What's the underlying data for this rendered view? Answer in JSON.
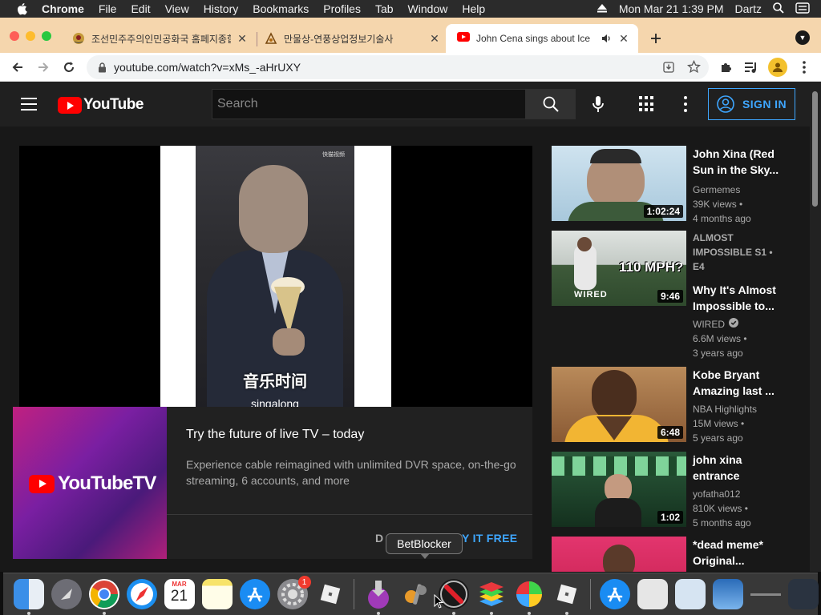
{
  "menubar": {
    "app": "Chrome",
    "items": [
      "File",
      "Edit",
      "View",
      "History",
      "Bookmarks",
      "Profiles",
      "Tab",
      "Window",
      "Help"
    ],
    "datetime": "Mon Mar 21  1:39 PM",
    "user": "Dartz"
  },
  "tabs": [
    {
      "title": "조선민주주의인민공화국 홈페지종합",
      "active": false
    },
    {
      "title": "만물상-연풍상업정보기술사",
      "active": false
    },
    {
      "title": "John Cena sings about Ice",
      "active": true
    }
  ],
  "toolbar": {
    "url": "youtube.com/watch?v=xMs_-aHrUXY"
  },
  "youtube": {
    "logo_text": "YouTube",
    "search_placeholder": "Search",
    "signin_label": "SIGN IN"
  },
  "video": {
    "watermark": "快猫视频",
    "caption": "音乐时间",
    "caption_sub": "singalong"
  },
  "promo": {
    "logo_text": "YouTubeTV",
    "title": "Try the future of live TV – today",
    "description": "Experience cable reimagined with unlimited DVR space, on-the-go streaming, 6 accounts, and more",
    "dismiss_label": "D",
    "try_label": "Y IT FREE"
  },
  "sidebar": [
    {
      "title": "John Xina (Red Sun in the Sky...",
      "channel": "Germemes",
      "views": "39K views",
      "age": "4 months ago",
      "duration": "1:02:24"
    },
    {
      "series": "ALMOST IMPOSSIBLE  S1 • E4",
      "title": "Why It's Almost Impossible to...",
      "channel": "WIRED",
      "verified": true,
      "views": "6.6M views",
      "age": "3 years ago",
      "duration": "9:46",
      "thumb_text": "110 MPH?",
      "thumb_brand": "WIRED"
    },
    {
      "title": "Kobe Bryant Amazing last ...",
      "channel": "NBA Highlights",
      "views": "15M views",
      "age": "5 years ago",
      "duration": "6:48"
    },
    {
      "title": "john xina entrance",
      "channel": "yofatha012",
      "views": "810K views",
      "age": "5 months ago",
      "duration": "1:02"
    },
    {
      "title": "*dead meme* Original...",
      "channel": "",
      "views": "",
      "age": "",
      "duration": ""
    }
  ],
  "dock": {
    "tooltip": "BetBlocker",
    "calendar_month": "MAR",
    "calendar_day": "21",
    "badge_count": "1"
  },
  "colors": {
    "tabstrip": "#f5d6ad",
    "yt_red": "#ff0000",
    "link_blue": "#3ea6ff"
  }
}
